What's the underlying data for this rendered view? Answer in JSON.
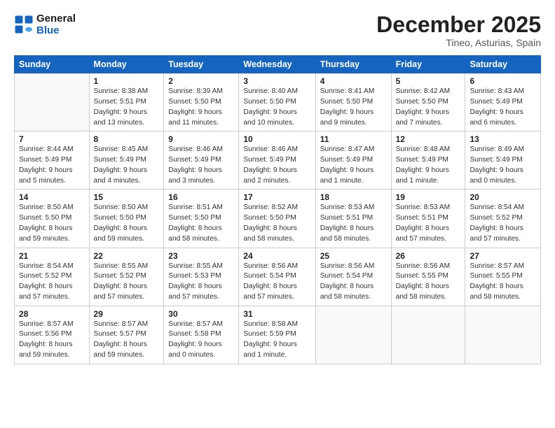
{
  "logo": {
    "line1": "General",
    "line2": "Blue"
  },
  "header": {
    "title": "December 2025",
    "location": "Tineo, Asturias, Spain"
  },
  "weekdays": [
    "Sunday",
    "Monday",
    "Tuesday",
    "Wednesday",
    "Thursday",
    "Friday",
    "Saturday"
  ],
  "weeks": [
    [
      {
        "num": "",
        "info": ""
      },
      {
        "num": "1",
        "info": "Sunrise: 8:38 AM\nSunset: 5:51 PM\nDaylight: 9 hours\nand 13 minutes."
      },
      {
        "num": "2",
        "info": "Sunrise: 8:39 AM\nSunset: 5:50 PM\nDaylight: 9 hours\nand 11 minutes."
      },
      {
        "num": "3",
        "info": "Sunrise: 8:40 AM\nSunset: 5:50 PM\nDaylight: 9 hours\nand 10 minutes."
      },
      {
        "num": "4",
        "info": "Sunrise: 8:41 AM\nSunset: 5:50 PM\nDaylight: 9 hours\nand 9 minutes."
      },
      {
        "num": "5",
        "info": "Sunrise: 8:42 AM\nSunset: 5:50 PM\nDaylight: 9 hours\nand 7 minutes."
      },
      {
        "num": "6",
        "info": "Sunrise: 8:43 AM\nSunset: 5:49 PM\nDaylight: 9 hours\nand 6 minutes."
      }
    ],
    [
      {
        "num": "7",
        "info": "Sunrise: 8:44 AM\nSunset: 5:49 PM\nDaylight: 9 hours\nand 5 minutes."
      },
      {
        "num": "8",
        "info": "Sunrise: 8:45 AM\nSunset: 5:49 PM\nDaylight: 9 hours\nand 4 minutes."
      },
      {
        "num": "9",
        "info": "Sunrise: 8:46 AM\nSunset: 5:49 PM\nDaylight: 9 hours\nand 3 minutes."
      },
      {
        "num": "10",
        "info": "Sunrise: 8:46 AM\nSunset: 5:49 PM\nDaylight: 9 hours\nand 2 minutes."
      },
      {
        "num": "11",
        "info": "Sunrise: 8:47 AM\nSunset: 5:49 PM\nDaylight: 9 hours\nand 1 minute."
      },
      {
        "num": "12",
        "info": "Sunrise: 8:48 AM\nSunset: 5:49 PM\nDaylight: 9 hours\nand 1 minute."
      },
      {
        "num": "13",
        "info": "Sunrise: 8:49 AM\nSunset: 5:49 PM\nDaylight: 9 hours\nand 0 minutes."
      }
    ],
    [
      {
        "num": "14",
        "info": "Sunrise: 8:50 AM\nSunset: 5:50 PM\nDaylight: 8 hours\nand 59 minutes."
      },
      {
        "num": "15",
        "info": "Sunrise: 8:50 AM\nSunset: 5:50 PM\nDaylight: 8 hours\nand 59 minutes."
      },
      {
        "num": "16",
        "info": "Sunrise: 8:51 AM\nSunset: 5:50 PM\nDaylight: 8 hours\nand 58 minutes."
      },
      {
        "num": "17",
        "info": "Sunrise: 8:52 AM\nSunset: 5:50 PM\nDaylight: 8 hours\nand 58 minutes."
      },
      {
        "num": "18",
        "info": "Sunrise: 8:53 AM\nSunset: 5:51 PM\nDaylight: 8 hours\nand 58 minutes."
      },
      {
        "num": "19",
        "info": "Sunrise: 8:53 AM\nSunset: 5:51 PM\nDaylight: 8 hours\nand 57 minutes."
      },
      {
        "num": "20",
        "info": "Sunrise: 8:54 AM\nSunset: 5:52 PM\nDaylight: 8 hours\nand 57 minutes."
      }
    ],
    [
      {
        "num": "21",
        "info": "Sunrise: 8:54 AM\nSunset: 5:52 PM\nDaylight: 8 hours\nand 57 minutes."
      },
      {
        "num": "22",
        "info": "Sunrise: 8:55 AM\nSunset: 5:52 PM\nDaylight: 8 hours\nand 57 minutes."
      },
      {
        "num": "23",
        "info": "Sunrise: 8:55 AM\nSunset: 5:53 PM\nDaylight: 8 hours\nand 57 minutes."
      },
      {
        "num": "24",
        "info": "Sunrise: 8:56 AM\nSunset: 5:54 PM\nDaylight: 8 hours\nand 57 minutes."
      },
      {
        "num": "25",
        "info": "Sunrise: 8:56 AM\nSunset: 5:54 PM\nDaylight: 8 hours\nand 58 minutes."
      },
      {
        "num": "26",
        "info": "Sunrise: 8:56 AM\nSunset: 5:55 PM\nDaylight: 8 hours\nand 58 minutes."
      },
      {
        "num": "27",
        "info": "Sunrise: 8:57 AM\nSunset: 5:55 PM\nDaylight: 8 hours\nand 58 minutes."
      }
    ],
    [
      {
        "num": "28",
        "info": "Sunrise: 8:57 AM\nSunset: 5:56 PM\nDaylight: 8 hours\nand 59 minutes."
      },
      {
        "num": "29",
        "info": "Sunrise: 8:57 AM\nSunset: 5:57 PM\nDaylight: 8 hours\nand 59 minutes."
      },
      {
        "num": "30",
        "info": "Sunrise: 8:57 AM\nSunset: 5:58 PM\nDaylight: 9 hours\nand 0 minutes."
      },
      {
        "num": "31",
        "info": "Sunrise: 8:58 AM\nSunset: 5:59 PM\nDaylight: 9 hours\nand 1 minute."
      },
      {
        "num": "",
        "info": ""
      },
      {
        "num": "",
        "info": ""
      },
      {
        "num": "",
        "info": ""
      }
    ]
  ]
}
